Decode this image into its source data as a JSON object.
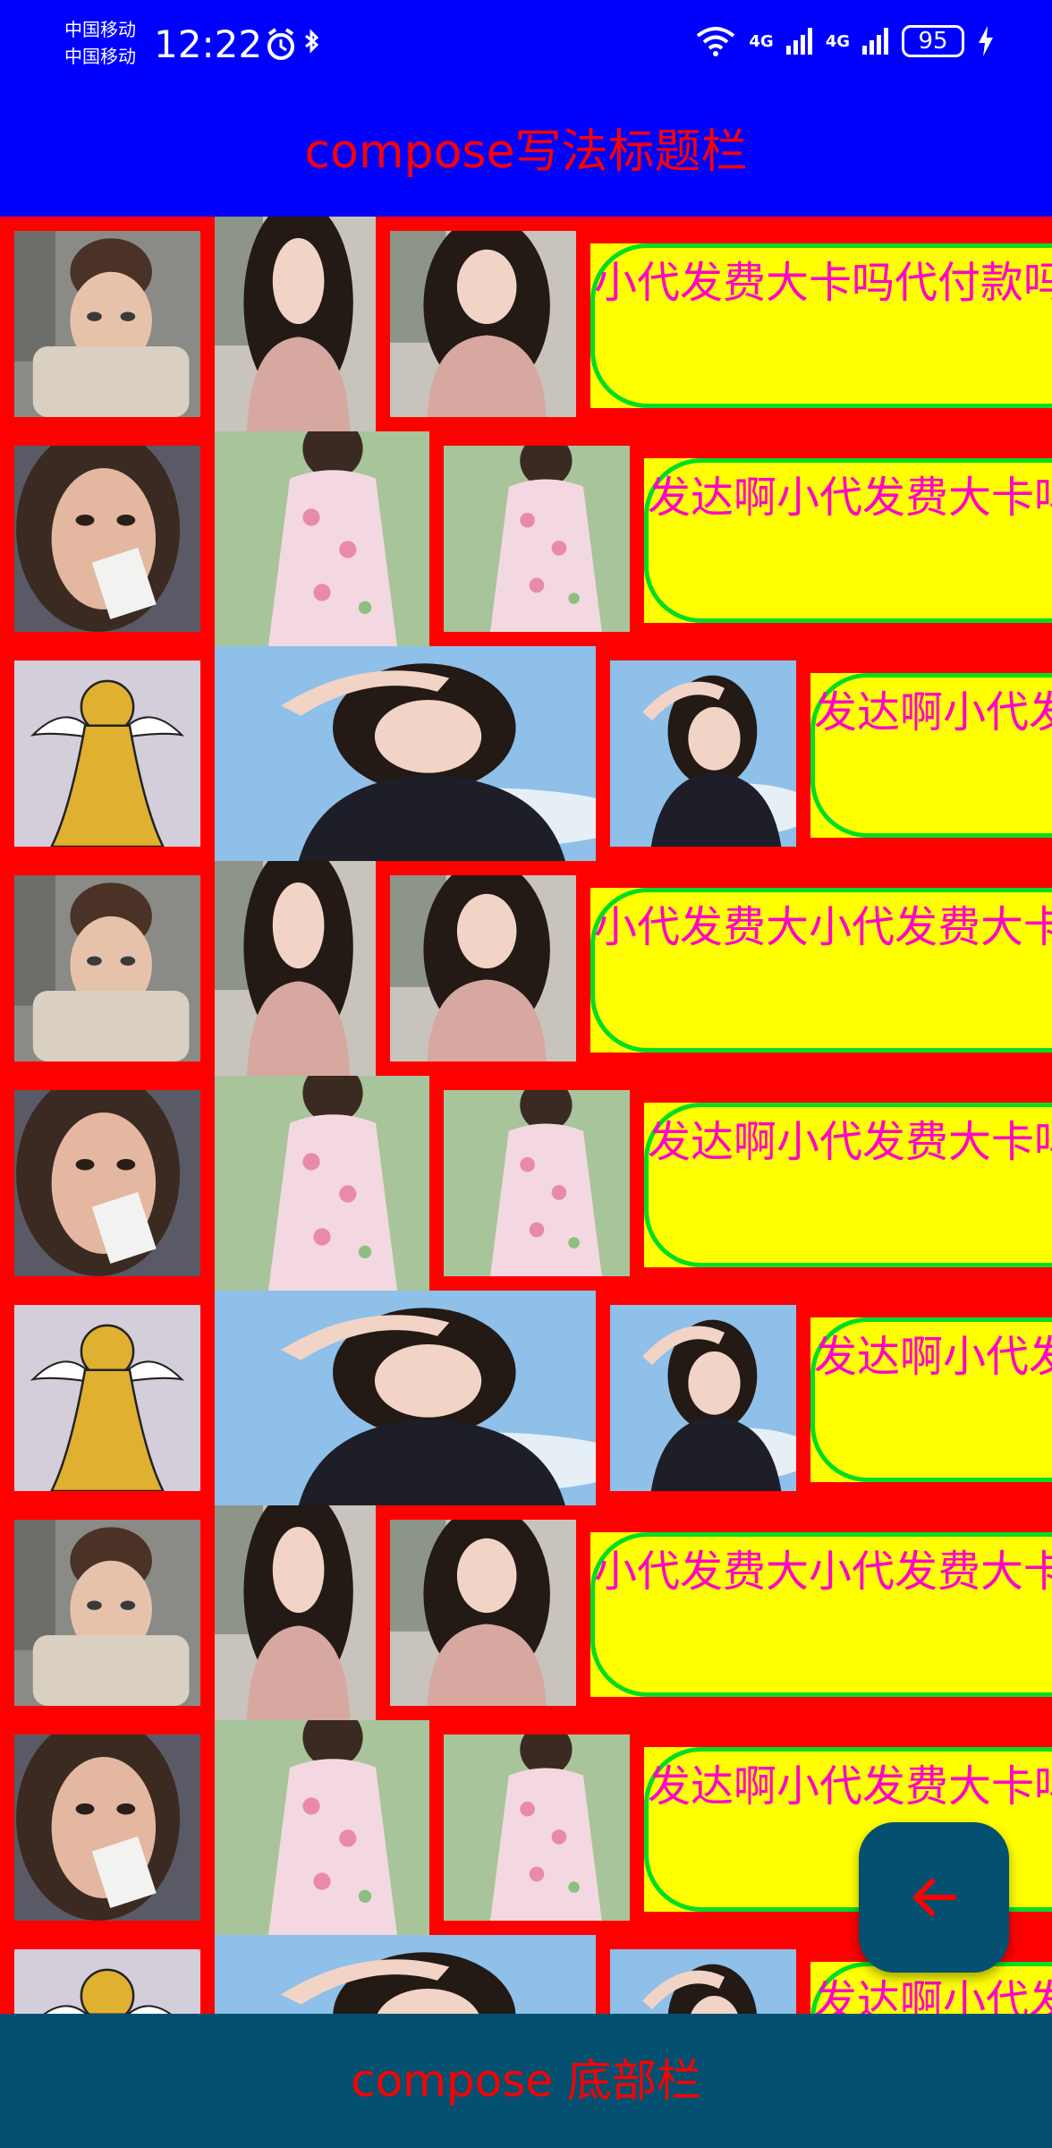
{
  "status_bar": {
    "carrier_1": "中国移动",
    "carrier_2": "中国移动",
    "time": "12:22",
    "net_1": "4G",
    "net_2": "4G",
    "battery": "95",
    "icons": [
      "alarm-icon",
      "bluetooth-icon",
      "wifi-icon",
      "signal-icon",
      "charging-icon"
    ]
  },
  "top_bar": {
    "title": "compose写法标题栏"
  },
  "rows": [
    {
      "photo_a": "woman-knit-sweater-photo",
      "photo_b": "woman-pink-top-photo",
      "photo_c": "woman-pink-top-photo",
      "chip_text": "小代发费大卡吗代付款吗"
    },
    {
      "photo_a": "woman-holding-polaroid-photo",
      "photo_b": "woman-floral-dress-photo",
      "photo_c": "woman-floral-dress-photo",
      "chip_text": "发达啊小代发费大卡吗"
    },
    {
      "photo_a": "yellow-bear-graffiti-photo",
      "photo_b": "woman-saluting-sky-photo",
      "photo_c": "woman-saluting-sky-photo",
      "chip_text": "发达啊小代发费大卡"
    },
    {
      "photo_a": "woman-knit-sweater-photo",
      "photo_b": "woman-pink-top-photo",
      "photo_c": "woman-pink-top-photo",
      "chip_text": "小代发费大小代发费大卡"
    },
    {
      "photo_a": "woman-holding-polaroid-photo",
      "photo_b": "woman-floral-dress-photo",
      "photo_c": "woman-floral-dress-photo",
      "chip_text": "发达啊小代发费大卡吗"
    },
    {
      "photo_a": "yellow-bear-graffiti-photo",
      "photo_b": "woman-saluting-sky-photo",
      "photo_c": "woman-saluting-sky-photo",
      "chip_text": "发达啊小代发费大卡"
    },
    {
      "photo_a": "woman-knit-sweater-photo",
      "photo_b": "woman-pink-top-photo",
      "photo_c": "woman-pink-top-photo",
      "chip_text": "小代发费大小代发费大卡"
    },
    {
      "photo_a": "woman-holding-polaroid-photo",
      "photo_b": "woman-floral-dress-photo",
      "photo_c": "woman-floral-dress-photo",
      "chip_text": "发达啊小代发费大卡吗"
    },
    {
      "photo_a": "yellow-bear-graffiti-photo",
      "photo_b": "woman-saluting-sky-photo",
      "photo_c": "woman-saluting-sky-photo",
      "chip_text": "发达啊小代发费大卡"
    }
  ],
  "fab": {
    "icon": "arrow-left-icon"
  },
  "bottom_bar": {
    "label": "compose 底部栏"
  },
  "colors": {
    "app_bar": "#0000ff",
    "background": "#ff0000",
    "chip_fill": "#ffff00",
    "chip_border": "#00dd22",
    "chip_text": "#ff00cc",
    "bottom_bar": "#045070",
    "bar_text": "#ff0000"
  }
}
